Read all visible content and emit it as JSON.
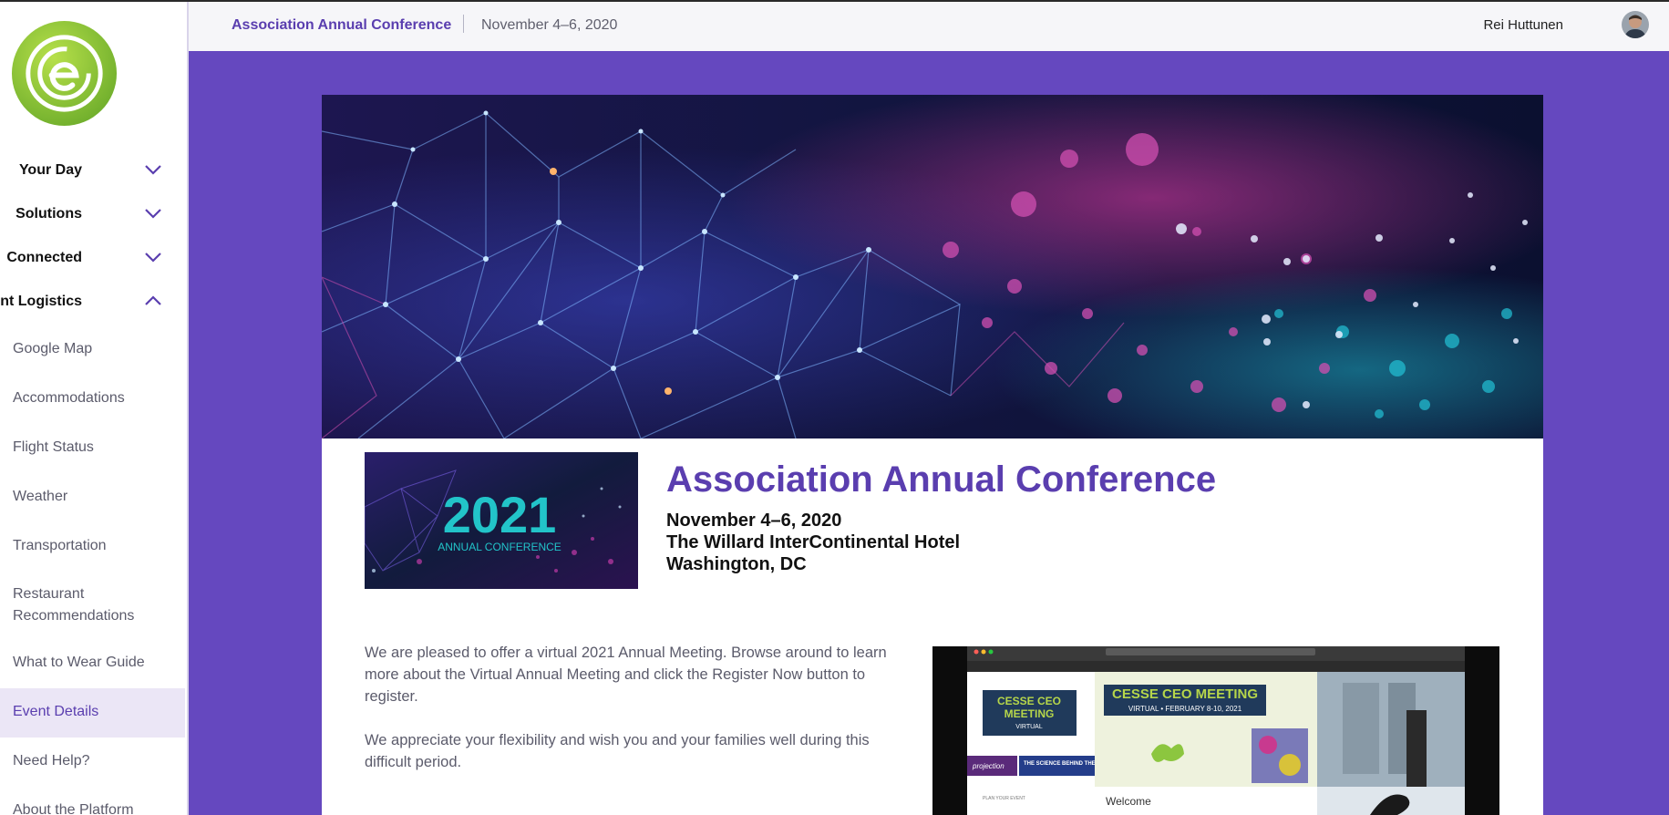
{
  "app": {
    "event_title": "Association Annual Conference",
    "event_dates": "November 4–6, 2020",
    "user_name": "Rei Huttunen"
  },
  "colors": {
    "brand_purple": "#5a3eaf",
    "page_bg": "#6548bf",
    "logo_green": "#8cc63f"
  },
  "sidebar": {
    "sections": [
      {
        "label": "Your Day",
        "expanded": false,
        "icon": "chevron-down-icon"
      },
      {
        "label": "Solutions",
        "expanded": false,
        "icon": "chevron-down-icon"
      },
      {
        "label": "Connected",
        "expanded": false,
        "icon": "chevron-down-icon"
      },
      {
        "label": "nt Logistics",
        "expanded": true,
        "icon": "chevron-up-icon"
      }
    ],
    "items": [
      {
        "label": "Google Map"
      },
      {
        "label": "Accommodations"
      },
      {
        "label": "Flight Status"
      },
      {
        "label": "Weather"
      },
      {
        "label": "Transportation"
      },
      {
        "label": "Restaurant Recommendations"
      },
      {
        "label": "What to Wear Guide"
      },
      {
        "label": "Event Details",
        "active": true
      },
      {
        "label": "Need Help?"
      },
      {
        "label": "About the Platform"
      }
    ]
  },
  "main": {
    "conference_title": "Association Annual Conference",
    "dates": "November 4–6, 2020",
    "venue": "The Willard InterContinental Hotel",
    "location": "Washington, DC",
    "thumb_year": "2021",
    "thumb_caption": "ANNUAL CONFERENCE",
    "paragraph_1": "We are pleased to offer a virtual 2021 Annual Meeting. Browse around to learn more about the Virtual Annual Meeting and click the Register Now button to register.",
    "paragraph_2": "We appreciate your flexibility and wish you and your families well during this difficult period.",
    "screenshot": {
      "badge_line1": "CESSE CEO",
      "badge_line2": "MEETING",
      "badge_line3": "VIRTUAL",
      "banner_title": "CESSE CEO MEETING",
      "banner_subtitle": "VIRTUAL • FEBRUARY 8-10, 2021",
      "side_tile_1": "projection",
      "side_tile_2": "THE SCIENCE BEHIND THE SCENES",
      "side_label": "PLAN YOUR EVENT",
      "welcome": "Welcome"
    }
  }
}
